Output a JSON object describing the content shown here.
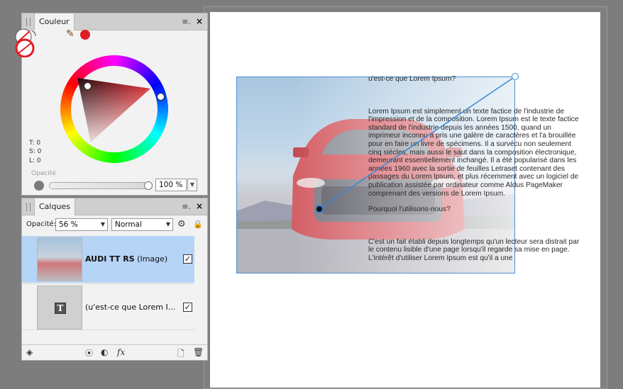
{
  "color_panel": {
    "tab": "Couleur",
    "menu_icon": "≡.",
    "close": "×",
    "hsl": {
      "t": "T: 0",
      "s": "S: 0",
      "l": "L: 0"
    },
    "opacity_label": "Opacité",
    "opacity_value": "100 %",
    "current_color": "#e31d25"
  },
  "layers_panel": {
    "tab": "Calques",
    "menu_icon": "≡.",
    "close": "×",
    "opacity_label": "Opacité:",
    "opacity_value": "56 %",
    "blend_mode": "Normal",
    "layers": [
      {
        "name": "AUDI TT RS",
        "type": "(Image)",
        "checked": "✓"
      },
      {
        "name": "(u'est-ce que Lorem I...",
        "type": "",
        "checked": "✓"
      }
    ],
    "bottom_icons": [
      "layers-icon",
      "mask-icon",
      "adjustment-icon",
      "fx-icon",
      "new-layer-icon",
      "trash-icon"
    ],
    "fx_label": "fx"
  },
  "document": {
    "text_title": "u'est-ce que Lorem Ipsum?",
    "text_body1": "Lorem Ipsum est simplement un texte factice de l'industrie de l'impression et de la composition. Lorem Ipsum est le texte factice standard de l'industrie depuis les années 1500, quand un imprimeur inconnu a pris une galère de caractères et l'a brouillée pour en faire un livre de spécimens. Il a survécu non seulement cinq siècles, mais aussi le saut dans la composition électronique, demeurant essentiellement inchangé. Il a été popularisé dans les années 1960 avec la sortie de feuilles Letraset contenant des passages du Lorem Ipsum, et plus récemment avec un logiciel de publication assistée par ordinateur comme Aldus PageMaker comprenant des versions de Lorem Ipsum.",
    "text_question": "Pourquoi l'utilisons-nous?",
    "text_body2": "C'est un fait établi depuis longtemps qu'un lecteur sera distrait par le contenu lisible d'une page lorsqu'il regarde sa mise en page. L'intérêt d'utiliser Lorem Ipsum est qu'il a une"
  }
}
